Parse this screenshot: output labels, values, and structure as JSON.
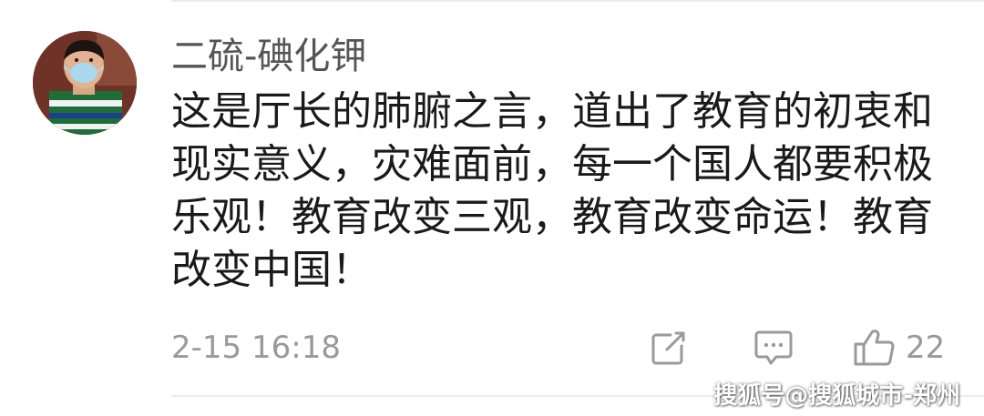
{
  "comment": {
    "username": "二硫-碘化钾",
    "text": "这是厅长的肺腑之言，道出了教育的初衷和现实意义，灾难面前，每一个国人都要积极乐观！教育改变三观，教育改变命运！教育改变中国！",
    "timestamp": "2-15 16:18",
    "actions": {
      "share_icon": "share-icon",
      "reply_icon": "comment-icon",
      "like_icon": "thumbs-up-icon",
      "like_count": "22"
    }
  },
  "watermark": {
    "text": "搜狐号@搜狐城市-郑州"
  },
  "colors": {
    "username": "#555555",
    "body_text": "#1a1a1a",
    "meta_text": "#999999",
    "icon": "#9a9a9a",
    "divider": "#ececec"
  }
}
